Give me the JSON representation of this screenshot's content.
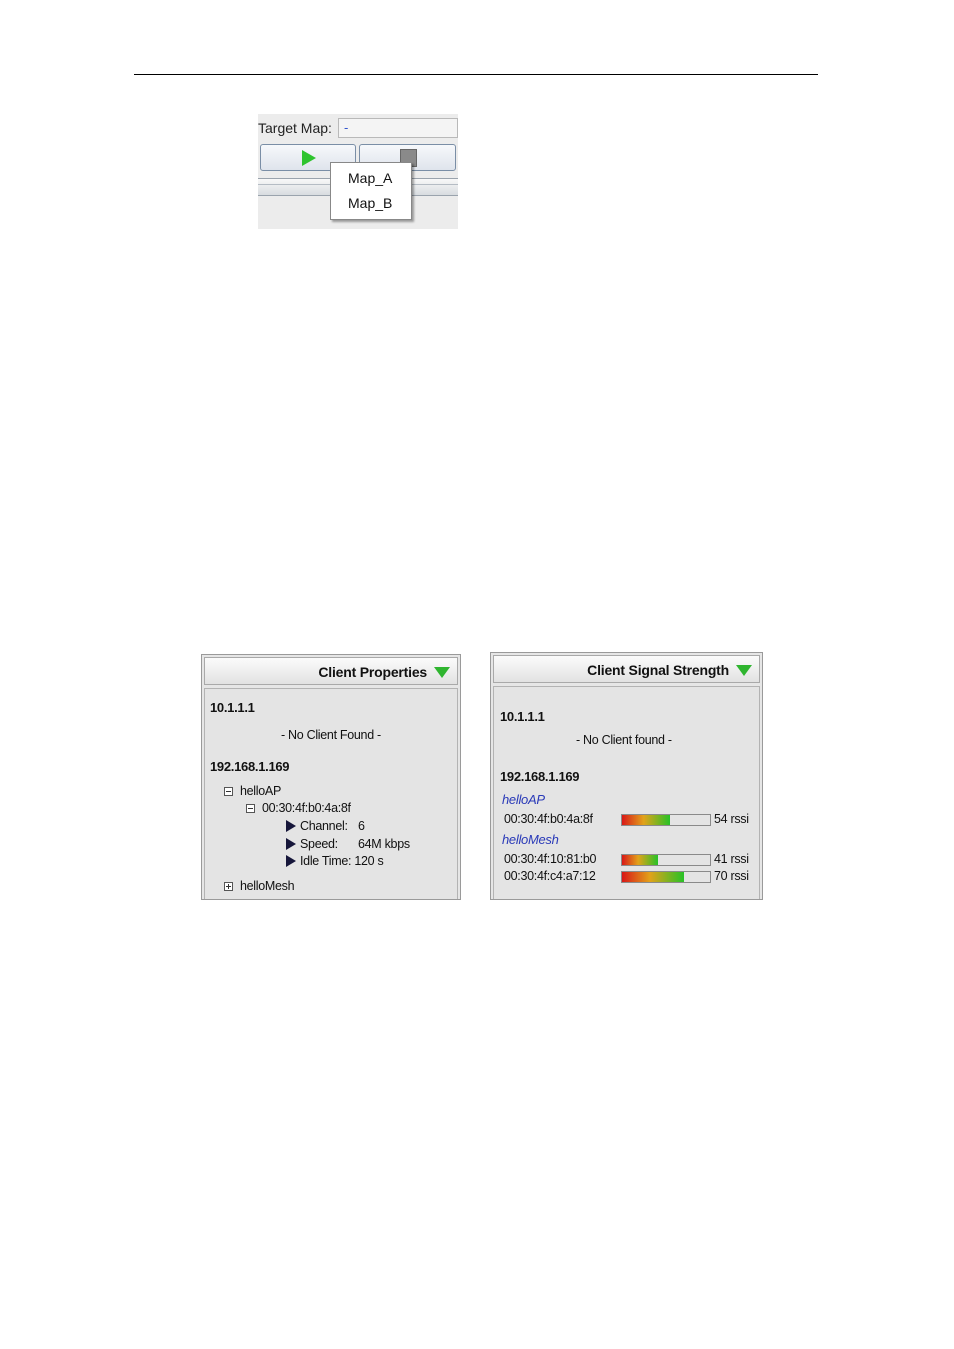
{
  "target_map": {
    "label": "Target Map:",
    "value": "-",
    "menu_items": [
      "Map_A",
      "Map_B"
    ]
  },
  "client_properties": {
    "title": "Client Properties",
    "ap1_ip": "10.1.1.1",
    "ap1_empty": "- No Client Found -",
    "ap2_ip": "192.168.1.169",
    "group1_name": "helloAP",
    "client_mac": "00:30:4f:b0:4a:8f",
    "channel_label": "Channel:",
    "channel_value": "6",
    "speed_label": "Speed:",
    "speed_value": "64M kbps",
    "idle_label": "Idle Time: 120 s",
    "group2_name": "helloMesh"
  },
  "client_signal": {
    "title": "Client Signal Strength",
    "ap1_ip": "10.1.1.1",
    "ap1_empty": "- No Client found -",
    "ap2_ip": "192.168.1.169",
    "group1_name": "helloAP",
    "group2_name": "helloMesh",
    "clients": [
      {
        "mac": "00:30:4f:b0:4a:8f",
        "rssi": 54,
        "label": "54 rssi"
      },
      {
        "mac": "00:30:4f:10:81:b0",
        "rssi": 41,
        "label": "41 rssi"
      },
      {
        "mac": "00:30:4f:c4:a7:12",
        "rssi": 70,
        "label": "70 rssi"
      }
    ],
    "rssi_max": 100
  }
}
